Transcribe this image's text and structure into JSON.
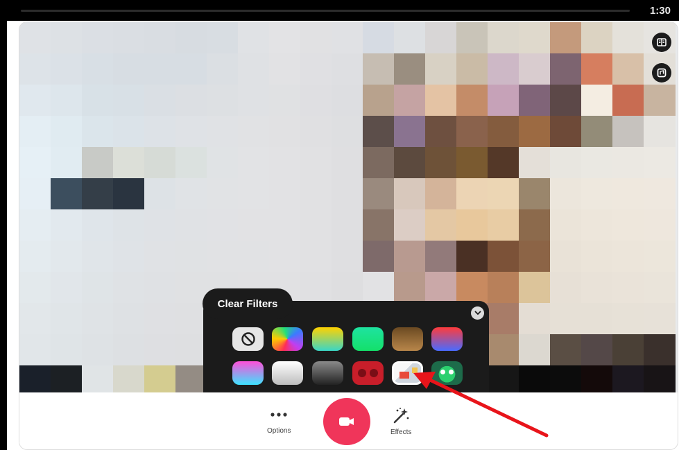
{
  "status_bar": {
    "time": "1:30"
  },
  "filters": {
    "clear_label": "Clear Filters",
    "row1": [
      {
        "name": "none",
        "icon": "no-filter-icon"
      },
      {
        "name": "rainbow",
        "colors": [
          "#ff2d55",
          "#ffcc00",
          "#3a7bff"
        ]
      },
      {
        "name": "teal-yellow",
        "colors": [
          "#ffd200",
          "#3ad6c6"
        ]
      },
      {
        "name": "green",
        "colors": [
          "#1ee3a0",
          "#14e06a"
        ]
      },
      {
        "name": "bronze",
        "colors": [
          "#6b4a22",
          "#b8864a"
        ]
      },
      {
        "name": "red-blue",
        "colors": [
          "#ff3b3b",
          "#4a6bff"
        ]
      }
    ],
    "row2": [
      {
        "name": "pink-cyan",
        "colors": [
          "#ff4fd8",
          "#3de3ff"
        ]
      },
      {
        "name": "white",
        "colors": [
          "#ffffff",
          "#bdbdbd"
        ]
      },
      {
        "name": "dark",
        "colors": [
          "#8a8a8a",
          "#222222"
        ]
      },
      {
        "name": "red-dots",
        "colors": [
          "#c81e2a",
          "#7a0e16"
        ]
      },
      {
        "name": "pixel",
        "colors": [
          "#f5f5f5",
          "#e84a3a"
        ],
        "selected": true
      },
      {
        "name": "monster",
        "colors": [
          "#1d6b4a",
          "#2bd06e"
        ]
      }
    ]
  },
  "controls": {
    "options_label": "Options",
    "effects_label": "Effects"
  }
}
